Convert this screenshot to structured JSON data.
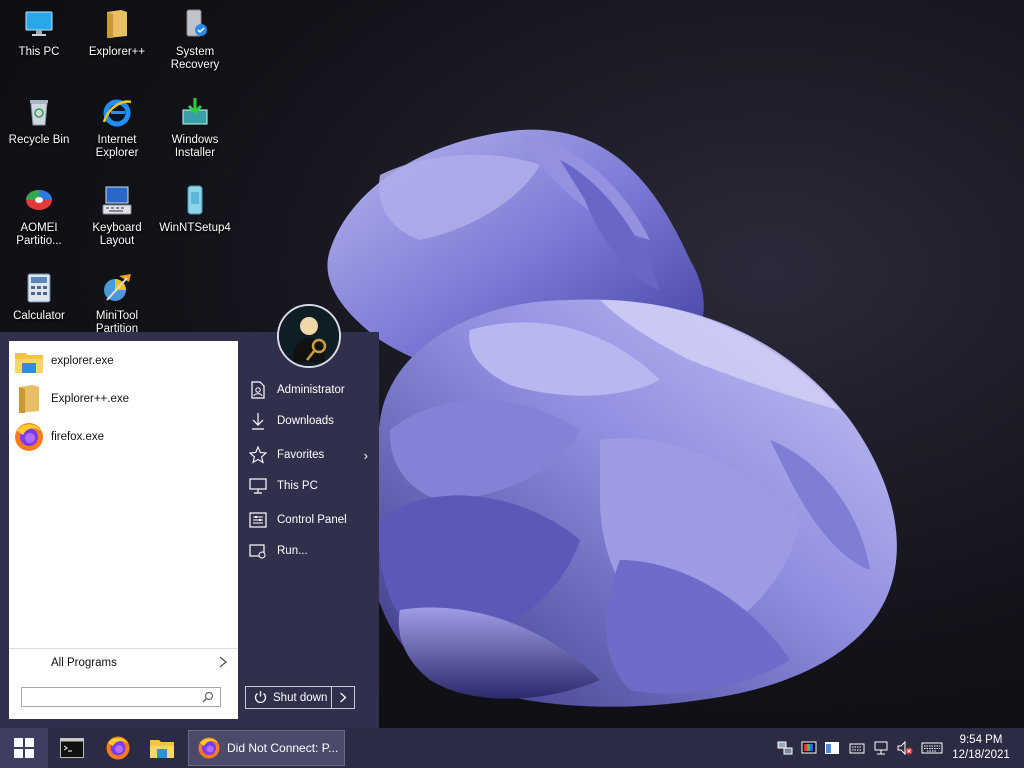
{
  "desktop": {
    "icons": [
      {
        "label": "This PC",
        "icon": "monitor-icon"
      },
      {
        "label": "Explorer++",
        "icon": "folder-icon"
      },
      {
        "label": "System Recovery",
        "icon": "recovery-icon"
      },
      {
        "label": "Recycle Bin",
        "icon": "recycle-bin-icon"
      },
      {
        "label": "Internet Explorer",
        "icon": "internet-explorer-icon"
      },
      {
        "label": "Windows Installer",
        "icon": "installer-icon"
      },
      {
        "label": "AOMEI Partitio...",
        "icon": "aomei-icon"
      },
      {
        "label": "Keyboard Layout",
        "icon": "keyboard-layout-icon"
      },
      {
        "label": "WinNTSetup4",
        "icon": "winntsetup-icon"
      },
      {
        "label": "Calculator",
        "icon": "calculator-icon"
      },
      {
        "label": "MiniTool Partition Wizard",
        "icon": "minitool-icon"
      }
    ]
  },
  "start_menu": {
    "programs": [
      {
        "label": "explorer.exe",
        "icon": "explorer-folder-icon"
      },
      {
        "label": "Explorer++.exe",
        "icon": "folder-icon"
      },
      {
        "label": "firefox.exe",
        "icon": "firefox-icon"
      }
    ],
    "all_programs": "All Programs",
    "search_placeholder": "",
    "user_icon": "user-avatar-icon",
    "right_items": [
      {
        "label": "Administrator",
        "icon": "user-doc-icon",
        "arrow": ""
      },
      {
        "label": "Downloads",
        "icon": "download-icon",
        "arrow": ""
      },
      {
        "label": "Favorites",
        "icon": "star-icon",
        "arrow": "›"
      },
      {
        "label": "This PC",
        "icon": "computer-icon",
        "arrow": ""
      },
      {
        "label": "Control Panel",
        "icon": "control-panel-icon",
        "arrow": ""
      },
      {
        "label": "Run...",
        "icon": "run-icon",
        "arrow": ""
      }
    ],
    "shutdown_label": "Shut down"
  },
  "taskbar": {
    "pinned": [
      {
        "icon": "cmd-icon"
      },
      {
        "icon": "firefox-icon"
      },
      {
        "icon": "file-explorer-icon"
      }
    ],
    "active_task": {
      "label": "Did Not Connect: P...",
      "icon": "firefox-icon"
    },
    "tray_icons": [
      "network-tray-icon",
      "display-tray-icon",
      "window-tray-icon",
      "keyboard-tray-icon",
      "ethernet-tray-icon",
      "volume-muted-icon",
      "input-keyboard-icon"
    ],
    "clock": {
      "time": "9:54 PM",
      "date": "12/18/2021"
    }
  },
  "colors": {
    "start_menu_bg": "#30304c",
    "taskbar_bg": "#2b2b44",
    "wallpaper_petal": "#7a7ad0"
  }
}
